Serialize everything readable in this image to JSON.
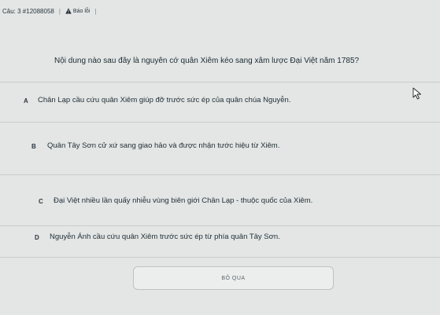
{
  "header": {
    "question_id": "Câu: 3 #12088058",
    "separator": "|",
    "report_label": "Báo lỗi",
    "report_icon": "warning-triangle-icon",
    "trailing_separator": "|"
  },
  "question": {
    "text": "Nội dung nào sau đây là nguyên cớ quân Xiêm kéo sang xâm lược Đại Việt năm 1785?"
  },
  "options": [
    {
      "letter": "A",
      "text": "Chân Lạp cầu cứu quân Xiêm giúp đỡ trước sức ép của quân chúa Nguyễn."
    },
    {
      "letter": "B",
      "text": "Quân Tây Sơn cử xứ sang giao hảo và được nhận tước hiệu từ Xiêm."
    },
    {
      "letter": "C",
      "text": "Đại Việt nhiều lần quấy nhiễu vùng biên giới Chân Lạp - thuộc quốc của Xiêm."
    },
    {
      "letter": "D",
      "text": "Nguyễn Ánh cầu cứu quân Xiêm trước sức ép từ phía quân Tây Sơn."
    }
  ],
  "actions": {
    "skip_label": "BỎ QUA"
  },
  "colors": {
    "background": "#e3e6e4",
    "text": "#1e2a30",
    "divider": "#c9cdca",
    "button_border": "#bcc4c0"
  },
  "icons": {
    "cursor": "mouse-pointer-icon"
  }
}
